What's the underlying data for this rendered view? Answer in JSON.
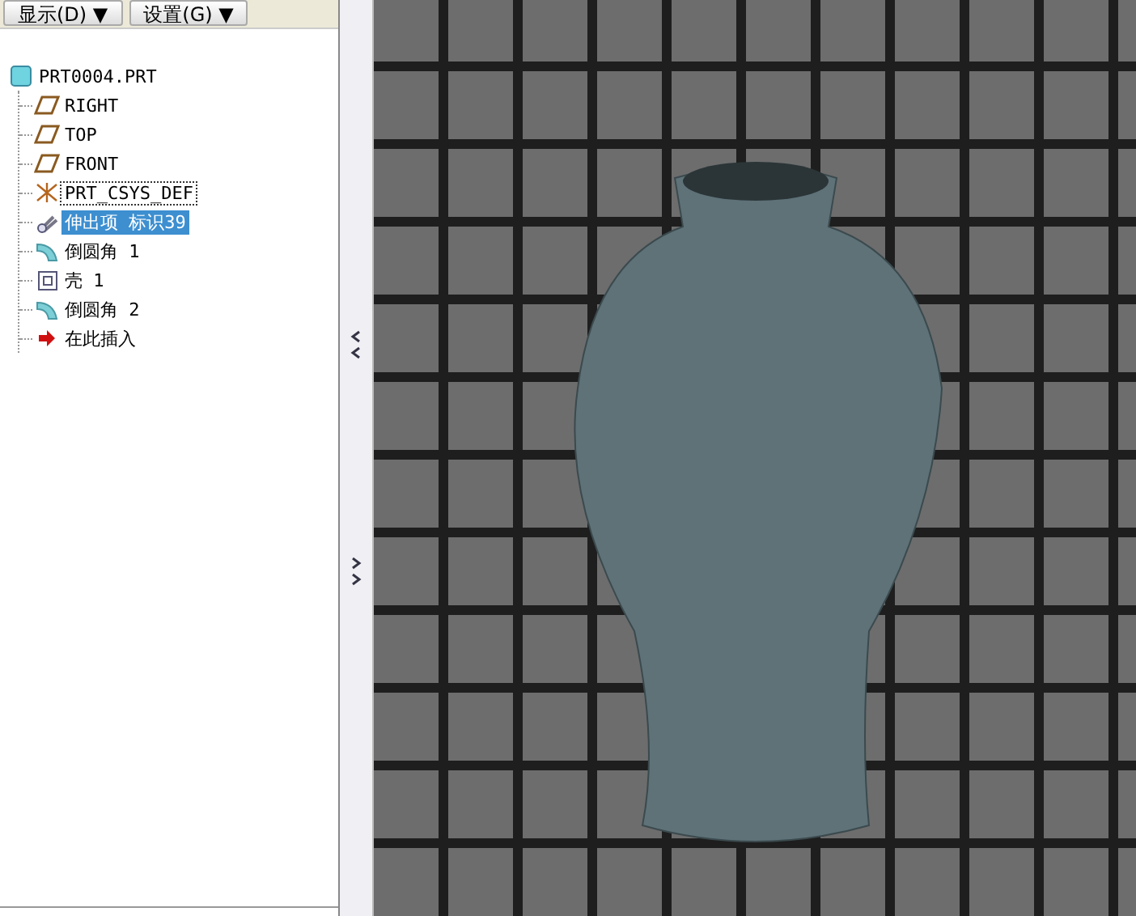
{
  "toolbar": {
    "buttons": [
      {
        "label": "显示(D)",
        "caret": "▼"
      },
      {
        "label": "设置(G)",
        "caret": "▼"
      }
    ]
  },
  "model_tree": {
    "root": {
      "label": "PRT0004.PRT",
      "kind": "part",
      "selected": false,
      "children": [
        {
          "label": "RIGHT",
          "kind": "plane",
          "selected": false
        },
        {
          "label": "TOP",
          "kind": "plane",
          "selected": false
        },
        {
          "label": "FRONT",
          "kind": "plane",
          "selected": false
        },
        {
          "label": "PRT_CSYS_DEF",
          "kind": "csys",
          "selected": false
        },
        {
          "label": "伸出项 标识39",
          "kind": "extrude",
          "selected": true
        },
        {
          "label": "倒圆角 1",
          "kind": "round",
          "selected": false
        },
        {
          "label": "壳 1",
          "kind": "shell",
          "selected": false
        },
        {
          "label": "倒圆角 2",
          "kind": "round",
          "selected": false
        },
        {
          "label": "在此插入",
          "kind": "insert",
          "selected": false
        }
      ]
    }
  }
}
